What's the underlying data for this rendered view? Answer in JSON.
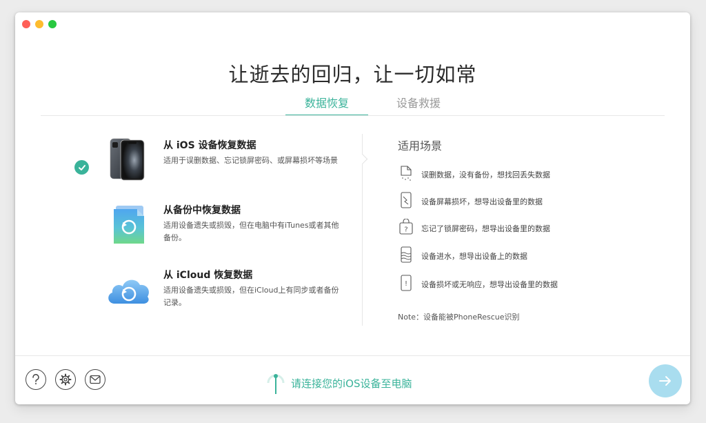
{
  "window": {
    "headline": "让逝去的回归，让一切如常"
  },
  "tabs": [
    {
      "label": "数据恢复",
      "active": true
    },
    {
      "label": "设备救援",
      "active": false
    }
  ],
  "options": [
    {
      "title": "从 iOS 设备恢复数据",
      "desc": "适用于误删数据、忘记锁屏密码、或屏幕损坏等场景",
      "icon": "iphone-icon",
      "selected": true
    },
    {
      "title": "从备份中恢复数据",
      "desc": "适用设备遗失或损毁，但在电脑中有iTunes或者其他备份。",
      "icon": "backup-file-icon",
      "selected": false
    },
    {
      "title": "从 iCloud 恢复数据",
      "desc": "适用设备遗失或损毁，但在iCloud上有同步或者备份记录。",
      "icon": "icloud-icon",
      "selected": false
    }
  ],
  "scenes": {
    "title": "适用场景",
    "items": [
      {
        "text": "误删数据，没有备份，想找回丢失数据",
        "icon": "deleted-file-icon"
      },
      {
        "text": "设备屏幕损坏，想导出设备里的数据",
        "icon": "broken-screen-icon"
      },
      {
        "text": "忘记了锁屏密码，想导出设备里的数据",
        "icon": "locked-device-icon"
      },
      {
        "text": "设备进水，想导出设备上的数据",
        "icon": "water-damage-icon"
      },
      {
        "text": "设备损坏或无响应，想导出设备里的数据",
        "icon": "unresponsive-device-icon"
      }
    ],
    "note": "Note：设备能被PhoneRescue识别"
  },
  "footer": {
    "connect_text": "请连接您的iOS设备至电脑",
    "help_icon": "help-icon",
    "settings_icon": "gear-icon",
    "mail_icon": "mail-icon",
    "next_icon": "arrow-right-icon"
  },
  "colors": {
    "accent": "#3ab39a",
    "next_button": "#a9ddef"
  }
}
